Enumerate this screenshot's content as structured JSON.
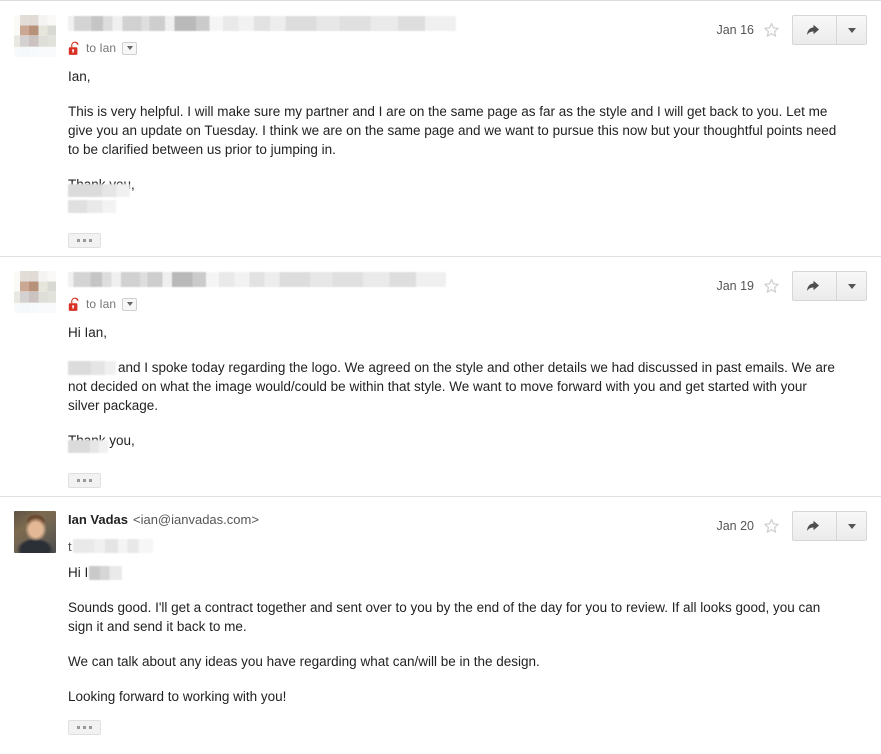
{
  "thread": {
    "messages": [
      {
        "id": "message-1",
        "avatar_type": "redacted",
        "sender_redacted": true,
        "to_label": "to Ian",
        "lock_icon": "open-padlock-icon",
        "date": "Jan 16",
        "star_icon": "star-outline-icon",
        "reply_icon": "reply-arrow-icon",
        "more_icon": "chevron-down-icon",
        "trim_icon": "ellipsis-icon",
        "body": {
          "greeting": "Ian,",
          "paragraph": "This is very helpful. I will make sure my partner and I are on the same page as far as the style and I will get back to you. Let me give you an update on Tuesday. I think we are on the same page and we want to pursue this now but your thoughtful points need to be clarified between us prior to jumping in.",
          "closing": "Thank you,",
          "signature_redacted": true
        }
      },
      {
        "id": "message-2",
        "avatar_type": "redacted",
        "sender_redacted": true,
        "to_label": "to Ian",
        "lock_icon": "open-padlock-icon",
        "date": "Jan 19",
        "star_icon": "star-outline-icon",
        "reply_icon": "reply-arrow-icon",
        "more_icon": "chevron-down-icon",
        "trim_icon": "ellipsis-icon",
        "body": {
          "greeting": "Hi Ian,",
          "paragraph_after_name": "and I spoke today regarding the logo. We agreed on the style and other details we had discussed in past emails. We are not decided on what the image would/could be within that style. We want to move forward with you and get started with your silver package.",
          "closing": "Thank you,",
          "signature_redacted": true
        }
      },
      {
        "id": "message-3",
        "avatar_type": "photo",
        "sender_redacted": false,
        "sender_name": "Ian Vadas",
        "sender_email": "<ian@ianvadas.com>",
        "to_prefix": "t",
        "date": "Jan 20",
        "star_icon": "star-outline-icon",
        "reply_icon": "reply-arrow-icon",
        "more_icon": "chevron-down-icon",
        "trim_icon": "ellipsis-icon",
        "body": {
          "greeting_prefix": "Hi I",
          "paragraph_1": "Sounds good. I'll get a contract together and sent over to you by the end of the day for you to review. If all looks good, you can sign it and send it back to me.",
          "paragraph_2": "We can talk about any ideas you have regarding what can/will be in the design.",
          "paragraph_3": "Looking forward to working with you!"
        }
      }
    ]
  },
  "colors": {
    "lock_red": "#d93025",
    "text": "#222222",
    "meta_text": "#777777",
    "divider": "#e0e0e0",
    "button_border": "#d6d6d6"
  }
}
